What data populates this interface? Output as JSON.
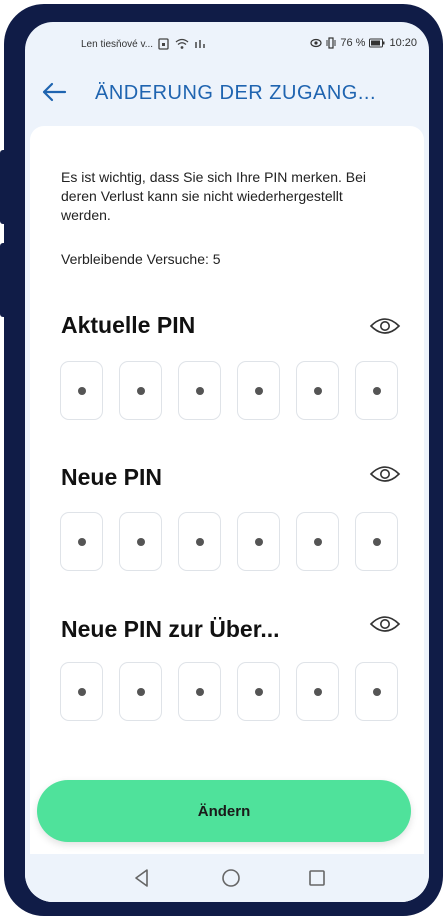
{
  "status_bar": {
    "carrier": "Len tiesňové v...",
    "battery": "76 %",
    "time": "10:20"
  },
  "header": {
    "title": "ÄNDERUNG DER ZUGANG..."
  },
  "info": {
    "text": "Es ist wichtig, dass Sie sich Ihre PIN merken. Bei deren Verlust kann sie nicht wiederhergestellt werden.",
    "attempts": "Verbleibende Versuche: 5"
  },
  "sections": [
    {
      "title": "Aktuelle PIN",
      "icon": "eye-icon",
      "digits": 6
    },
    {
      "title": "Neue PIN",
      "icon": "eye-icon",
      "digits": 6
    },
    {
      "title": "Neue PIN zur Über...",
      "icon": "eye-icon",
      "digits": 6
    }
  ],
  "submit": {
    "label": "Ändern"
  },
  "colors": {
    "header": "#1f64b0",
    "button": "#4fe29b",
    "frame": "#101c47",
    "background": "#edf3fb"
  }
}
